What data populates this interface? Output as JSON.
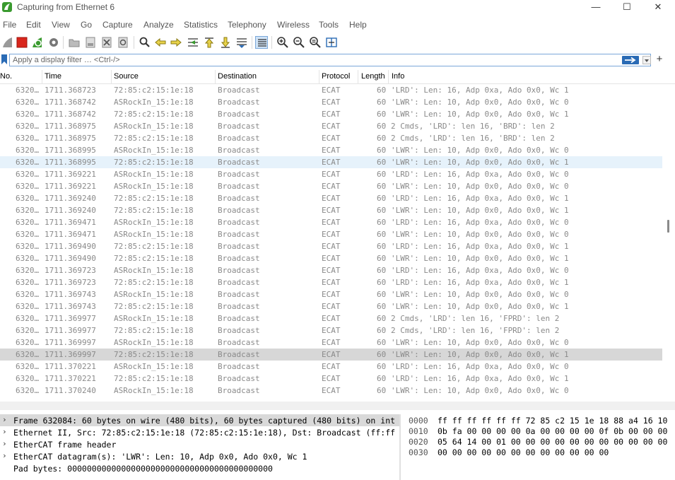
{
  "window": {
    "title": "Capturing from Ethernet 6",
    "minimize": "—",
    "maximize": "☐",
    "close": "✕"
  },
  "menu": [
    "File",
    "Edit",
    "View",
    "Go",
    "Capture",
    "Analyze",
    "Statistics",
    "Telephony",
    "Wireless",
    "Tools",
    "Help"
  ],
  "filter": {
    "placeholder": "Apply a display filter … <Ctrl-/>",
    "value": ""
  },
  "columns": [
    "No.",
    "Time",
    "Source",
    "Destination",
    "Protocol",
    "Length",
    "Info"
  ],
  "packets": [
    {
      "no": "6320…",
      "time": "1711.368723",
      "src": "72:85:c2:15:1e:18",
      "dst": "Broadcast",
      "proto": "ECAT",
      "len": "60",
      "info": "'LRD': Len: 16, Adp 0xa, Ado 0x0, Wc 1"
    },
    {
      "no": "6320…",
      "time": "1711.368742",
      "src": "ASRockIn_15:1e:18",
      "dst": "Broadcast",
      "proto": "ECAT",
      "len": "60",
      "info": "'LWR': Len: 10, Adp 0x0, Ado 0x0, Wc 0"
    },
    {
      "no": "6320…",
      "time": "1711.368742",
      "src": "72:85:c2:15:1e:18",
      "dst": "Broadcast",
      "proto": "ECAT",
      "len": "60",
      "info": "'LWR': Len: 10, Adp 0x0, Ado 0x0, Wc 1"
    },
    {
      "no": "6320…",
      "time": "1711.368975",
      "src": "ASRockIn_15:1e:18",
      "dst": "Broadcast",
      "proto": "ECAT",
      "len": "60",
      "info": "2 Cmds, 'LRD': len 16, 'BRD': len 2"
    },
    {
      "no": "6320…",
      "time": "1711.368975",
      "src": "72:85:c2:15:1e:18",
      "dst": "Broadcast",
      "proto": "ECAT",
      "len": "60",
      "info": "2 Cmds, 'LRD': len 16, 'BRD': len 2"
    },
    {
      "no": "6320…",
      "time": "1711.368995",
      "src": "ASRockIn_15:1e:18",
      "dst": "Broadcast",
      "proto": "ECAT",
      "len": "60",
      "info": "'LWR': Len: 10, Adp 0x0, Ado 0x0, Wc 0"
    },
    {
      "no": "6320…",
      "time": "1711.368995",
      "src": "72:85:c2:15:1e:18",
      "dst": "Broadcast",
      "proto": "ECAT",
      "len": "60",
      "info": "'LWR': Len: 10, Adp 0x0, Ado 0x0, Wc 1"
    },
    {
      "no": "6320…",
      "time": "1711.369221",
      "src": "ASRockIn_15:1e:18",
      "dst": "Broadcast",
      "proto": "ECAT",
      "len": "60",
      "info": "'LRD': Len: 16, Adp 0xa, Ado 0x0, Wc 0"
    },
    {
      "no": "6320…",
      "time": "1711.369221",
      "src": "ASRockIn_15:1e:18",
      "dst": "Broadcast",
      "proto": "ECAT",
      "len": "60",
      "info": "'LWR': Len: 10, Adp 0x0, Ado 0x0, Wc 0"
    },
    {
      "no": "6320…",
      "time": "1711.369240",
      "src": "72:85:c2:15:1e:18",
      "dst": "Broadcast",
      "proto": "ECAT",
      "len": "60",
      "info": "'LRD': Len: 16, Adp 0xa, Ado 0x0, Wc 1"
    },
    {
      "no": "6320…",
      "time": "1711.369240",
      "src": "72:85:c2:15:1e:18",
      "dst": "Broadcast",
      "proto": "ECAT",
      "len": "60",
      "info": "'LWR': Len: 10, Adp 0x0, Ado 0x0, Wc 1"
    },
    {
      "no": "6320…",
      "time": "1711.369471",
      "src": "ASRockIn_15:1e:18",
      "dst": "Broadcast",
      "proto": "ECAT",
      "len": "60",
      "info": "'LRD': Len: 16, Adp 0xa, Ado 0x0, Wc 0"
    },
    {
      "no": "6320…",
      "time": "1711.369471",
      "src": "ASRockIn_15:1e:18",
      "dst": "Broadcast",
      "proto": "ECAT",
      "len": "60",
      "info": "'LWR': Len: 10, Adp 0x0, Ado 0x0, Wc 0"
    },
    {
      "no": "6320…",
      "time": "1711.369490",
      "src": "72:85:c2:15:1e:18",
      "dst": "Broadcast",
      "proto": "ECAT",
      "len": "60",
      "info": "'LRD': Len: 16, Adp 0xa, Ado 0x0, Wc 1"
    },
    {
      "no": "6320…",
      "time": "1711.369490",
      "src": "72:85:c2:15:1e:18",
      "dst": "Broadcast",
      "proto": "ECAT",
      "len": "60",
      "info": "'LWR': Len: 10, Adp 0x0, Ado 0x0, Wc 1"
    },
    {
      "no": "6320…",
      "time": "1711.369723",
      "src": "ASRockIn_15:1e:18",
      "dst": "Broadcast",
      "proto": "ECAT",
      "len": "60",
      "info": "'LRD': Len: 16, Adp 0xa, Ado 0x0, Wc 0"
    },
    {
      "no": "6320…",
      "time": "1711.369723",
      "src": "72:85:c2:15:1e:18",
      "dst": "Broadcast",
      "proto": "ECAT",
      "len": "60",
      "info": "'LRD': Len: 16, Adp 0xa, Ado 0x0, Wc 1"
    },
    {
      "no": "6320…",
      "time": "1711.369743",
      "src": "ASRockIn_15:1e:18",
      "dst": "Broadcast",
      "proto": "ECAT",
      "len": "60",
      "info": "'LWR': Len: 10, Adp 0x0, Ado 0x0, Wc 0"
    },
    {
      "no": "6320…",
      "time": "1711.369743",
      "src": "72:85:c2:15:1e:18",
      "dst": "Broadcast",
      "proto": "ECAT",
      "len": "60",
      "info": "'LWR': Len: 10, Adp 0x0, Ado 0x0, Wc 1"
    },
    {
      "no": "6320…",
      "time": "1711.369977",
      "src": "ASRockIn_15:1e:18",
      "dst": "Broadcast",
      "proto": "ECAT",
      "len": "60",
      "info": "2 Cmds, 'LRD': len 16, 'FPRD': len 2"
    },
    {
      "no": "6320…",
      "time": "1711.369977",
      "src": "72:85:c2:15:1e:18",
      "dst": "Broadcast",
      "proto": "ECAT",
      "len": "60",
      "info": "2 Cmds, 'LRD': len 16, 'FPRD': len 2"
    },
    {
      "no": "6320…",
      "time": "1711.369997",
      "src": "ASRockIn_15:1e:18",
      "dst": "Broadcast",
      "proto": "ECAT",
      "len": "60",
      "info": "'LWR': Len: 10, Adp 0x0, Ado 0x0, Wc 0"
    },
    {
      "no": "6320…",
      "time": "1711.369997",
      "src": "72:85:c2:15:1e:18",
      "dst": "Broadcast",
      "proto": "ECAT",
      "len": "60",
      "info": "'LWR': Len: 10, Adp 0x0, Ado 0x0, Wc 1"
    },
    {
      "no": "6320…",
      "time": "1711.370221",
      "src": "ASRockIn_15:1e:18",
      "dst": "Broadcast",
      "proto": "ECAT",
      "len": "60",
      "info": "'LRD': Len: 16, Adp 0xa, Ado 0x0, Wc 0"
    },
    {
      "no": "6320…",
      "time": "1711.370221",
      "src": "72:85:c2:15:1e:18",
      "dst": "Broadcast",
      "proto": "ECAT",
      "len": "60",
      "info": "'LRD': Len: 16, Adp 0xa, Ado 0x0, Wc 1"
    },
    {
      "no": "6320…",
      "time": "1711.370240",
      "src": "ASRockIn_15:1e:18",
      "dst": "Broadcast",
      "proto": "ECAT",
      "len": "60",
      "info": "'LWR': Len: 10, Adp 0x0, Ado 0x0, Wc 0"
    }
  ],
  "selected_row": 6,
  "marked_row": 22,
  "details": [
    {
      "text": "Frame 632084: 60 bytes on wire (480 bits), 60 bytes captured (480 bits) on int",
      "expand": "›"
    },
    {
      "text": "Ethernet II, Src: 72:85:c2:15:1e:18 (72:85:c2:15:1e:18), Dst: Broadcast (ff:ff",
      "expand": "›"
    },
    {
      "text": "EtherCAT frame header",
      "expand": "›"
    },
    {
      "text": "EtherCAT datagram(s): 'LWR': Len: 10, Adp 0x0, Ado 0x0, Wc 1",
      "expand": "›"
    },
    {
      "text": "Pad bytes: 000000000000000000000000000000000000000000",
      "expand": ""
    }
  ],
  "bytes": [
    {
      "offset": "0000",
      "hex": "ff ff ff ff ff ff 72 85  c2 15 1e 18 88 a4 16 10"
    },
    {
      "offset": "0010",
      "hex": "0b fa 00 00 00 00 0a 00  00 00 00 0f 0b 00 00 00"
    },
    {
      "offset": "0020",
      "hex": "05 64 14 00 01 00 00 00  00 00 00 00 00 00 00 00"
    },
    {
      "offset": "0030",
      "hex": "00 00 00 00 00 00 00 00  00 00 00 00"
    }
  ],
  "colors": {
    "accent": "#2a6bb5",
    "selected_row": "#e6f2fb",
    "marked_row": "#d7d7d7",
    "row_text": "#8a8a8a",
    "record_red": "#d9261c",
    "restart_green": "#3a9a2f"
  },
  "icons": [
    "shark-fin-start-icon",
    "stop-capture-icon",
    "restart-capture-icon",
    "capture-options-icon",
    "open-file-icon",
    "save-file-icon",
    "close-file-icon",
    "reload-file-icon",
    "find-packet-icon",
    "go-back-icon",
    "go-forward-icon",
    "go-to-packet-icon",
    "go-first-icon",
    "go-last-icon",
    "autoscroll-icon",
    "colorize-icon",
    "zoom-in-icon",
    "zoom-out-icon",
    "zoom-normal-icon",
    "resize-columns-icon"
  ]
}
